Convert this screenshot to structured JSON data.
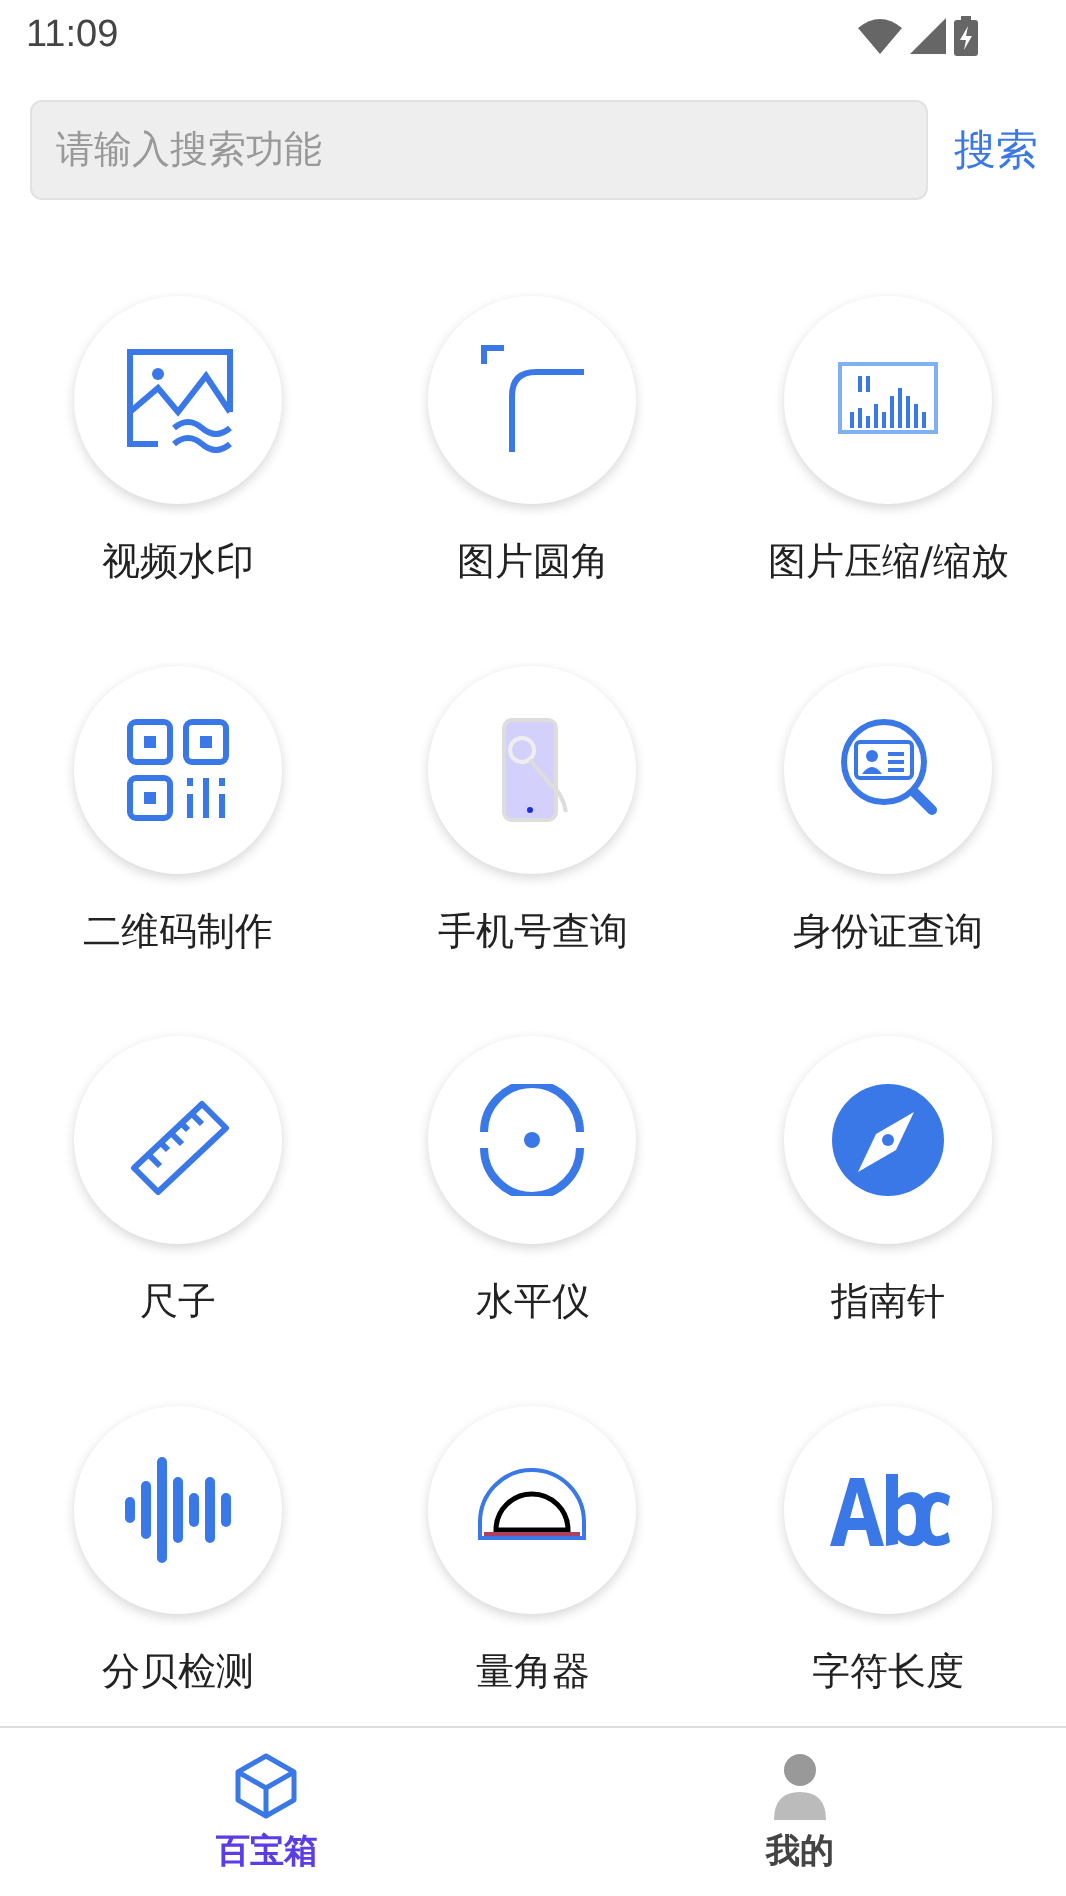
{
  "status_bar": {
    "time": "11:09"
  },
  "search": {
    "placeholder": "请输入搜索功能",
    "button": "搜索"
  },
  "tools": [
    {
      "label": "视频水印"
    },
    {
      "label": "图片圆角"
    },
    {
      "label": "图片压缩/缩放"
    },
    {
      "label": "二维码制作"
    },
    {
      "label": "手机号查询"
    },
    {
      "label": "身份证查询"
    },
    {
      "label": "尺子"
    },
    {
      "label": "水平仪"
    },
    {
      "label": "指南针"
    },
    {
      "label": "分贝检测"
    },
    {
      "label": "量角器"
    },
    {
      "label": "字符长度"
    }
  ],
  "tabs": [
    {
      "label": "百宝箱",
      "selected": true
    },
    {
      "label": "我的",
      "selected": false
    }
  ]
}
